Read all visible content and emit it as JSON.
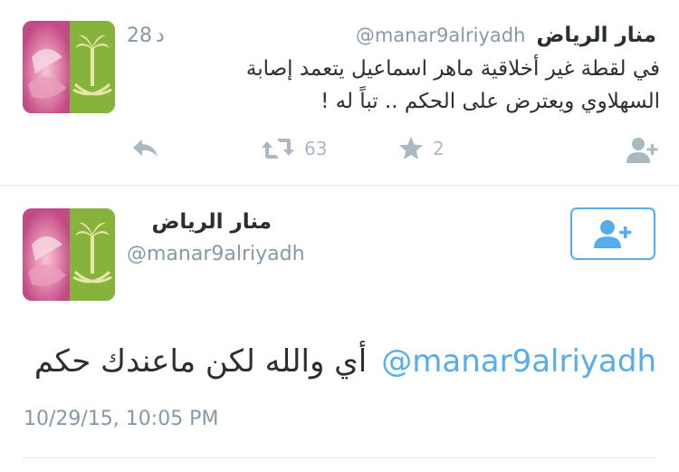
{
  "tweet1": {
    "display_name": "منار الرياض",
    "handle": "@manar9alriyadh",
    "time_value": "28",
    "time_unit": "د",
    "text_line1": "في لقطة غير أخلاقية ماهر اسماعيل يتعمد إصابة",
    "text_line2": "السهلاوي ويعترض على الحكم .. تباً له !",
    "retweet_count": "63",
    "favorite_count": "2"
  },
  "tweet2": {
    "display_name": "منار الرياض",
    "handle": "@manar9alriyadh",
    "mention": "@manar9alriyadh",
    "text": "أي والله لكن ماعندك حكم",
    "timestamp": "10/29/15, 10:05 PM"
  },
  "colors": {
    "accent": "#55acee",
    "muted": "#8899a6",
    "icon": "#aab8c2",
    "text": "#292f33",
    "divider": "#e1e8ed"
  },
  "icons": {
    "reply": "reply-icon",
    "retweet": "retweet-icon",
    "favorite": "star-icon",
    "follow": "follow-icon"
  }
}
